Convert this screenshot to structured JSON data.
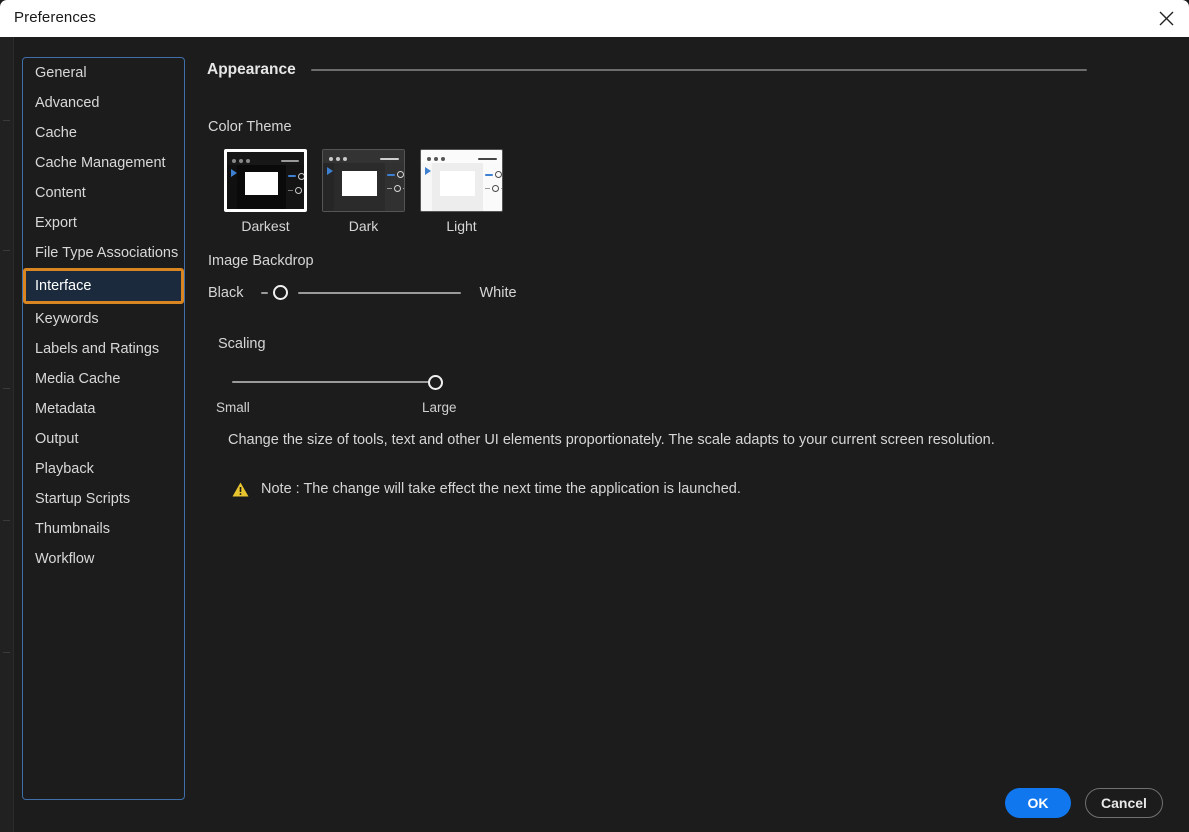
{
  "window": {
    "title": "Preferences",
    "close_icon": "close-icon"
  },
  "sidebar": {
    "items": [
      {
        "label": "General",
        "selected": false
      },
      {
        "label": "Advanced",
        "selected": false
      },
      {
        "label": "Cache",
        "selected": false
      },
      {
        "label": "Cache Management",
        "selected": false
      },
      {
        "label": "Content",
        "selected": false
      },
      {
        "label": "Export",
        "selected": false
      },
      {
        "label": "File Type Associations",
        "selected": false
      },
      {
        "label": "Interface",
        "selected": true
      },
      {
        "label": "Keywords",
        "selected": false
      },
      {
        "label": "Labels and Ratings",
        "selected": false
      },
      {
        "label": "Media Cache",
        "selected": false
      },
      {
        "label": "Metadata",
        "selected": false
      },
      {
        "label": "Output",
        "selected": false
      },
      {
        "label": "Playback",
        "selected": false
      },
      {
        "label": "Startup Scripts",
        "selected": false
      },
      {
        "label": "Thumbnails",
        "selected": false
      },
      {
        "label": "Workflow",
        "selected": false
      }
    ]
  },
  "appearance": {
    "section_title": "Appearance",
    "color_theme_label": "Color Theme",
    "themes": [
      {
        "label": "Darkest",
        "selected": true
      },
      {
        "label": "Dark",
        "selected": false
      },
      {
        "label": "Light",
        "selected": false
      }
    ],
    "image_backdrop": {
      "label": "Image Backdrop",
      "min_label": "Black",
      "max_label": "White",
      "value_percent": 6
    },
    "scaling": {
      "label": "Scaling",
      "min_label": "Small",
      "max_label": "Large",
      "value_percent": 96,
      "description": "Change the size of tools, text and other UI elements proportionately. The scale adapts to your current screen resolution.",
      "note_icon": "warning-triangle-icon",
      "note": "Note : The change will take effect the next time the application is launched."
    }
  },
  "footer": {
    "ok_label": "OK",
    "cancel_label": "Cancel"
  },
  "colors": {
    "accent_blue": "#1177ee",
    "highlight_orange": "#d98521",
    "sidebar_border": "#3f6ea8",
    "selected_row_bg": "#1b2a3d",
    "warning_yellow": "#e8c52e",
    "dialog_bg": "#1c1c1c",
    "titlebar_bg": "#ffffff"
  }
}
